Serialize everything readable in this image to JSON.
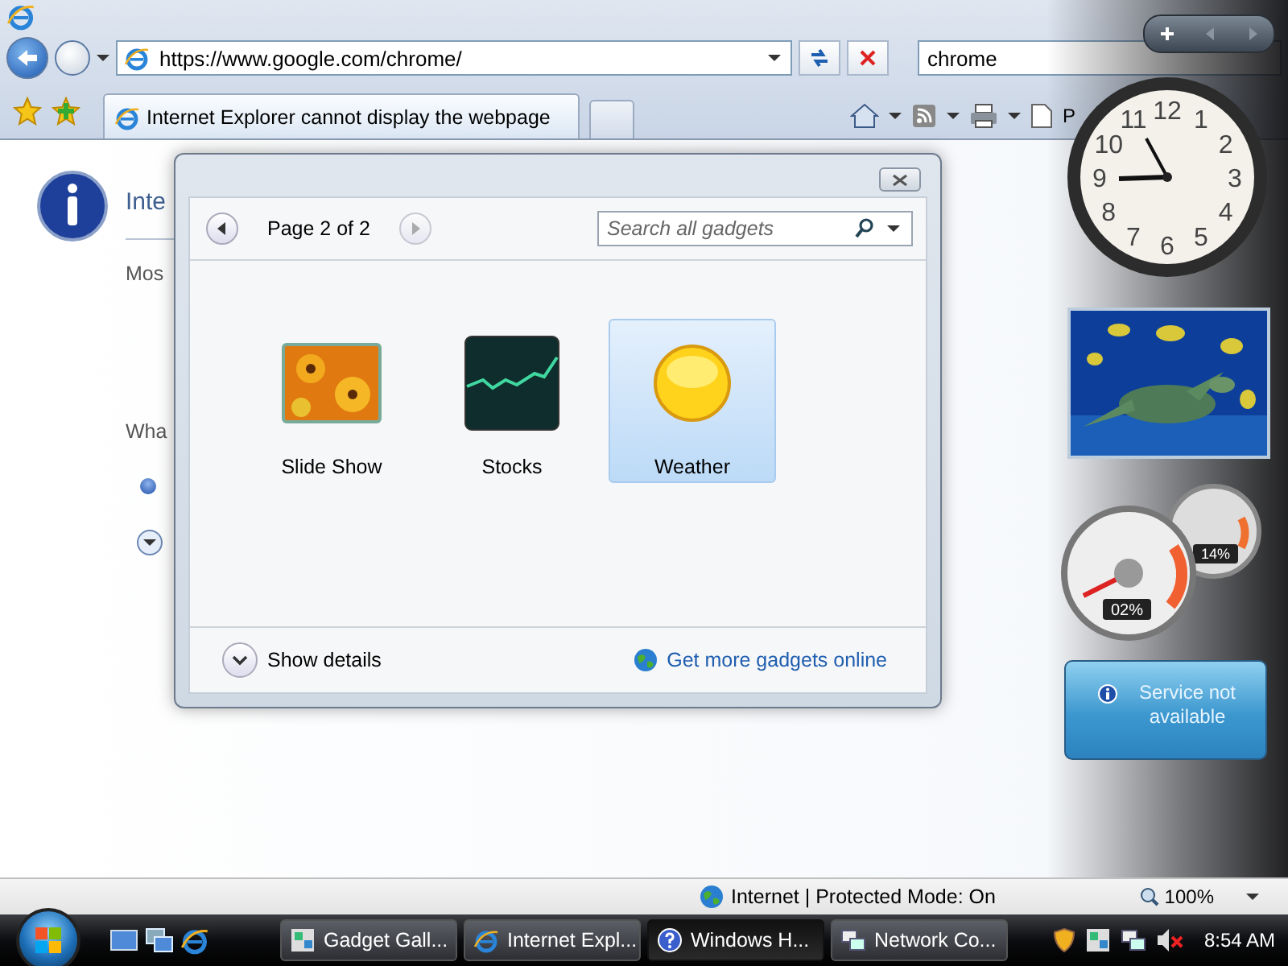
{
  "browser": {
    "address": "https://www.google.com/chrome/",
    "search": "chrome",
    "tabs": [
      {
        "label": "Internet Explorer cannot display the webpage",
        "selected": true
      }
    ],
    "page_tool": "P",
    "page": {
      "heading": "Inte",
      "text": "Mos",
      "question": "Wha"
    },
    "status": "Internet | Protected Mode: On",
    "zoom": "100%"
  },
  "gallery": {
    "page_label": "Page 2 of 2",
    "search_placeholder": "Search all gadgets",
    "gadgets": [
      {
        "name": "Slide Show",
        "kind": "slideshow",
        "selected": false
      },
      {
        "name": "Stocks",
        "kind": "stocks",
        "selected": false
      },
      {
        "name": "Weather",
        "kind": "weather",
        "selected": true
      }
    ],
    "details_label": "Show details",
    "online_link": "Get more gadgets online"
  },
  "sidebar": {
    "clock_numerals": [
      "11",
      "12",
      "1",
      "10",
      "2",
      "9",
      "3",
      "8",
      "4",
      "7",
      "6",
      "5"
    ],
    "meters": [
      {
        "reading": "02%"
      },
      {
        "reading": "14%"
      }
    ],
    "weather_message": "Service not available"
  },
  "taskbar": {
    "buttons": [
      {
        "label": "Gadget Gall...",
        "kind": "gadget",
        "selected": false
      },
      {
        "label": "Internet Expl...",
        "kind": "ie",
        "selected": false
      },
      {
        "label": "Windows H...",
        "kind": "help",
        "selected": true
      },
      {
        "label": "Network Co...",
        "kind": "network",
        "selected": false
      }
    ],
    "time": "8:54 AM"
  }
}
